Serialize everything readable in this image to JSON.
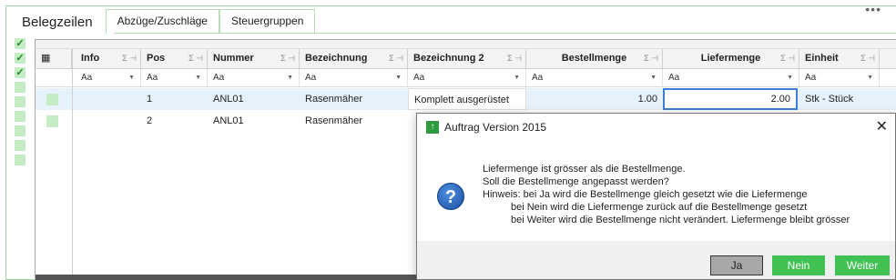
{
  "tabs": {
    "active": "Belegzeilen",
    "items": [
      "Abzüge/Zuschläge",
      "Steuergruppen"
    ]
  },
  "more_menu": "•••",
  "grid": {
    "columns": [
      "Info",
      "Pos",
      "Nummer",
      "Bezeichnung",
      "Bezeichnung 2",
      "Bestellmenge",
      "Liefermenge",
      "Einheit"
    ],
    "sum_icon": "Σ ⊣",
    "filter_glyph": "Aa",
    "rows": [
      {
        "pos": "1",
        "nummer": "ANL01",
        "bezeichnung": "Rasenmäher",
        "bezeichnung2": "Komplett ausgerüstet",
        "bestellmenge": "1.00",
        "liefermenge": "2.00",
        "einheit": "Stk - Stück"
      },
      {
        "pos": "2",
        "nummer": "ANL01",
        "bezeichnung": "Rasenmäher",
        "bezeichnung2": "",
        "bestellmenge": "",
        "liefermenge": "",
        "einheit": ""
      }
    ]
  },
  "dialog": {
    "title": "Auftrag Version 2015",
    "close": "✕",
    "icon": "question-icon",
    "lines": [
      "Liefermenge ist grösser als die Bestellmenge.",
      "Soll die Bestellmenge angepasst werden?",
      "Hinweis: bei Ja wird die Bestellmenge gleich gesetzt wie die Liefermenge",
      "bei Nein wird die Liefermenge zurück auf die Bestellmenge gesetzt",
      "bei Weiter wird die Bestellmenge nicht verändert. Liefermenge bleibt grösser"
    ],
    "buttons": {
      "ja": "Ja",
      "nein": "Nein",
      "weiter": "Weiter"
    }
  },
  "colors": {
    "accent_green": "#3fc253",
    "selection_blue": "#3d7fd6"
  }
}
